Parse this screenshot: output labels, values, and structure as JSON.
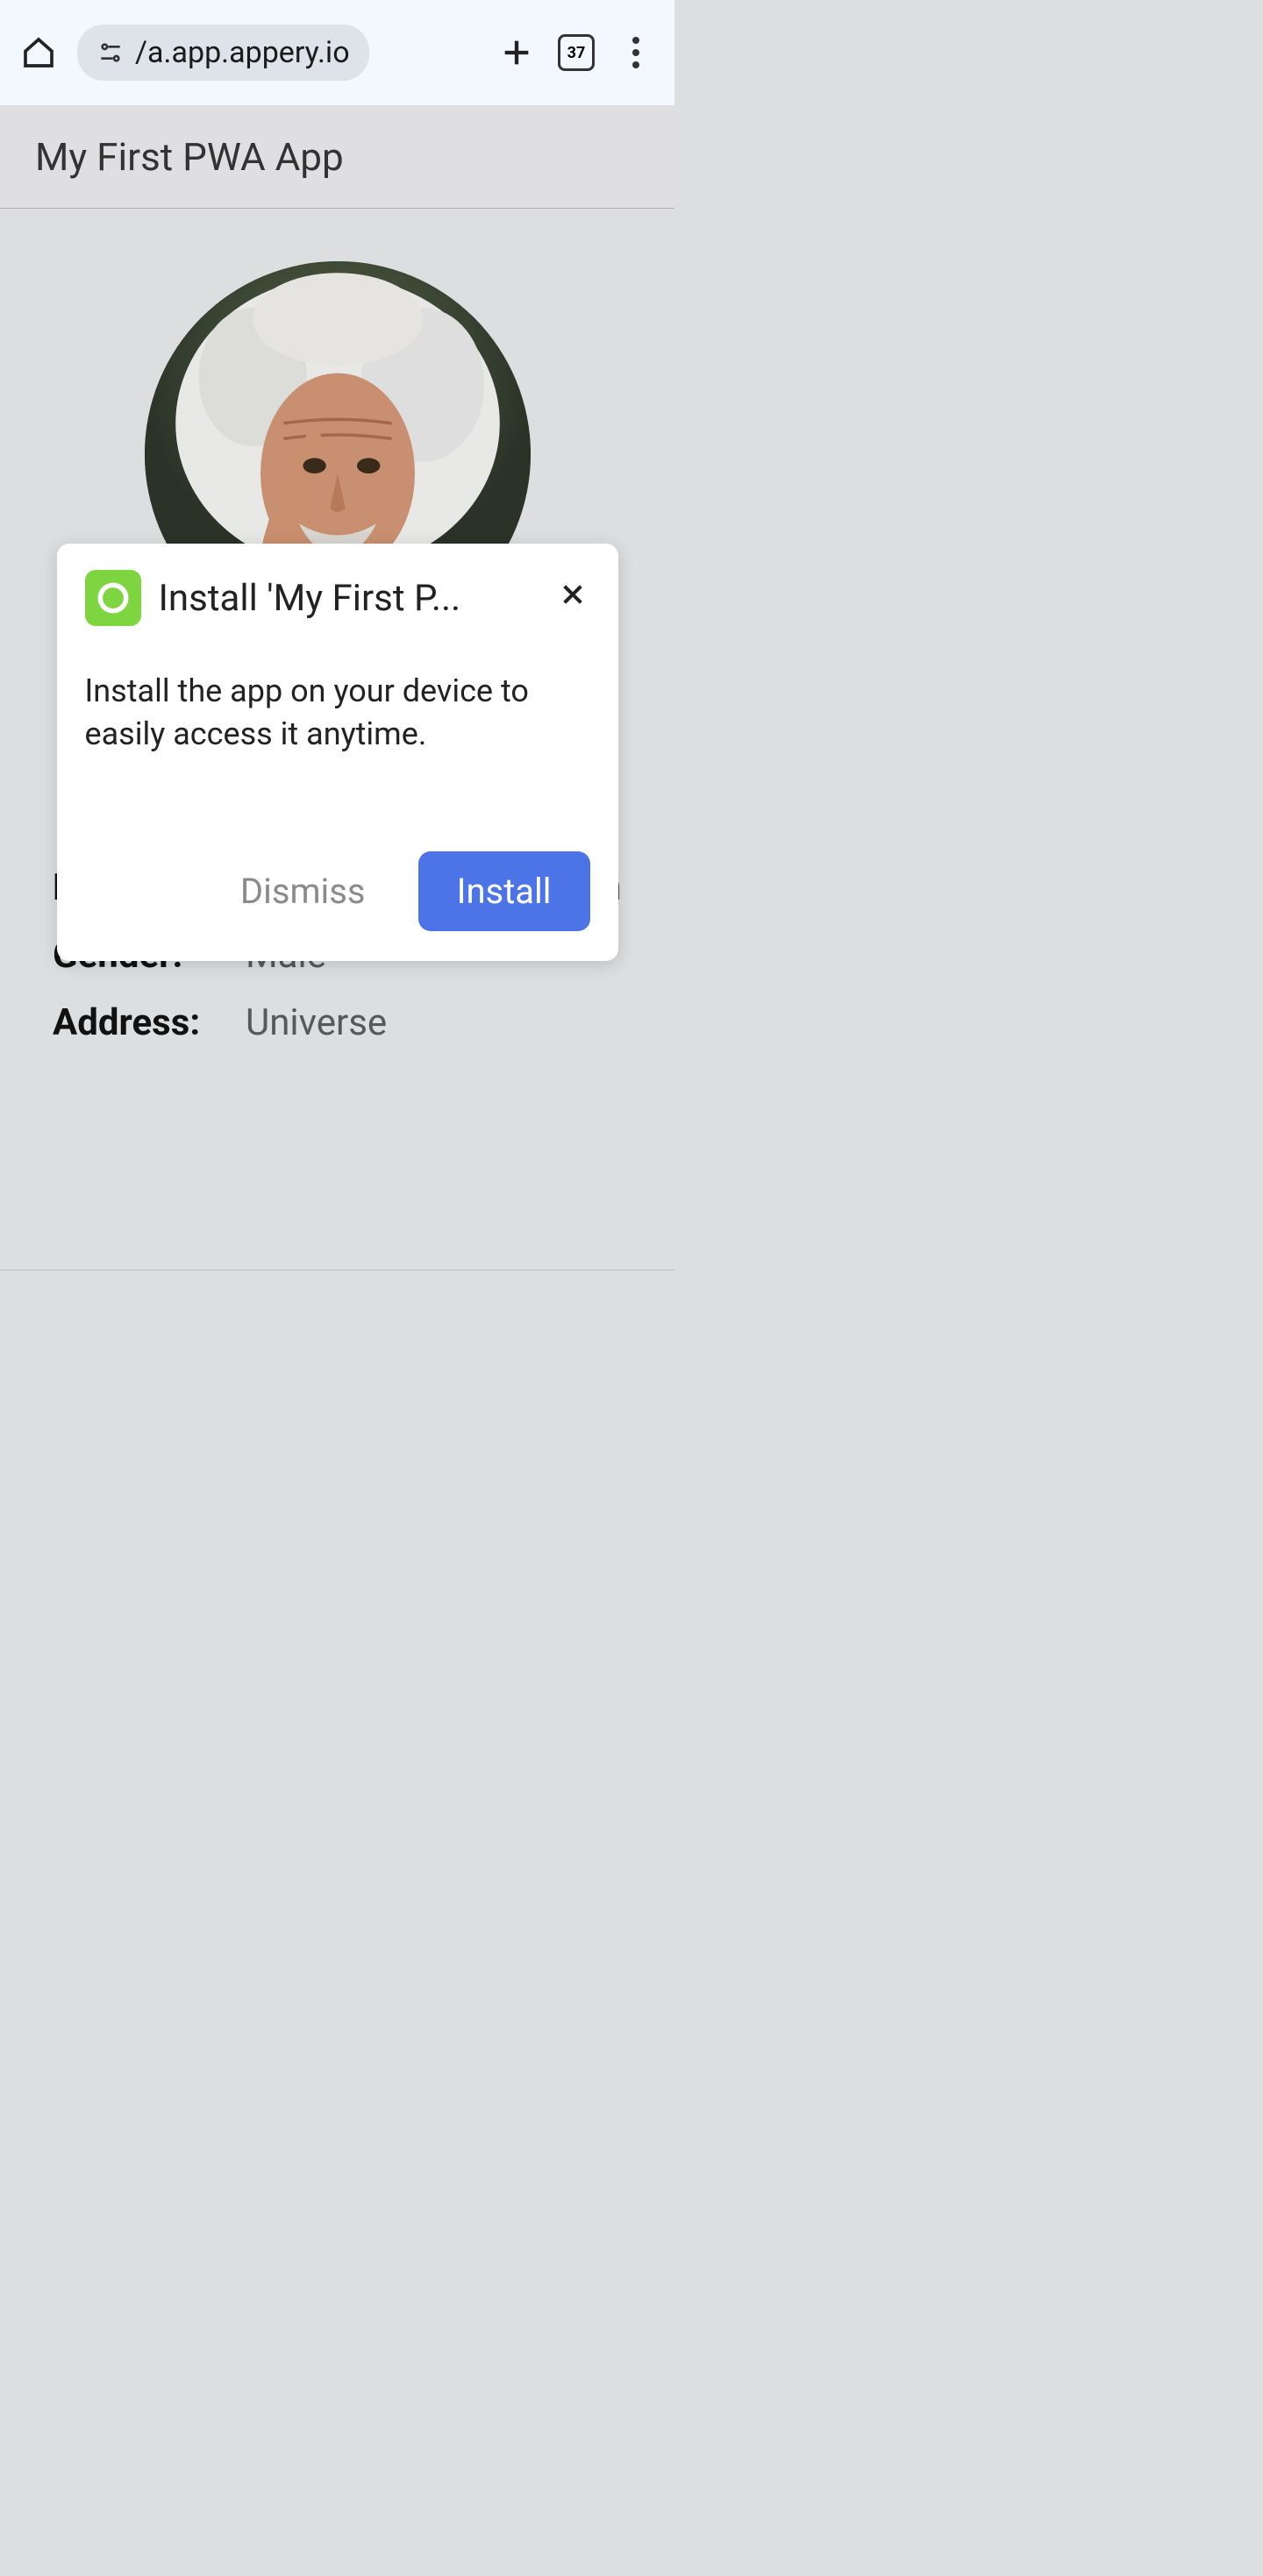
{
  "browser": {
    "url_display": "/a.app.appery.io",
    "tab_count": "37"
  },
  "app": {
    "header_title": "My First PWA App"
  },
  "profile": {
    "email_label": "Email:",
    "email_value": "appery.user@gmail.com",
    "gender_label": "Gender:",
    "gender_value": "Male",
    "address_label": "Address:",
    "address_value": "Universe"
  },
  "modal": {
    "title": "Install 'My First P...",
    "body": "Install the app on your device to easily access it anytime.",
    "dismiss_label": "Dismiss",
    "install_label": "Install"
  }
}
